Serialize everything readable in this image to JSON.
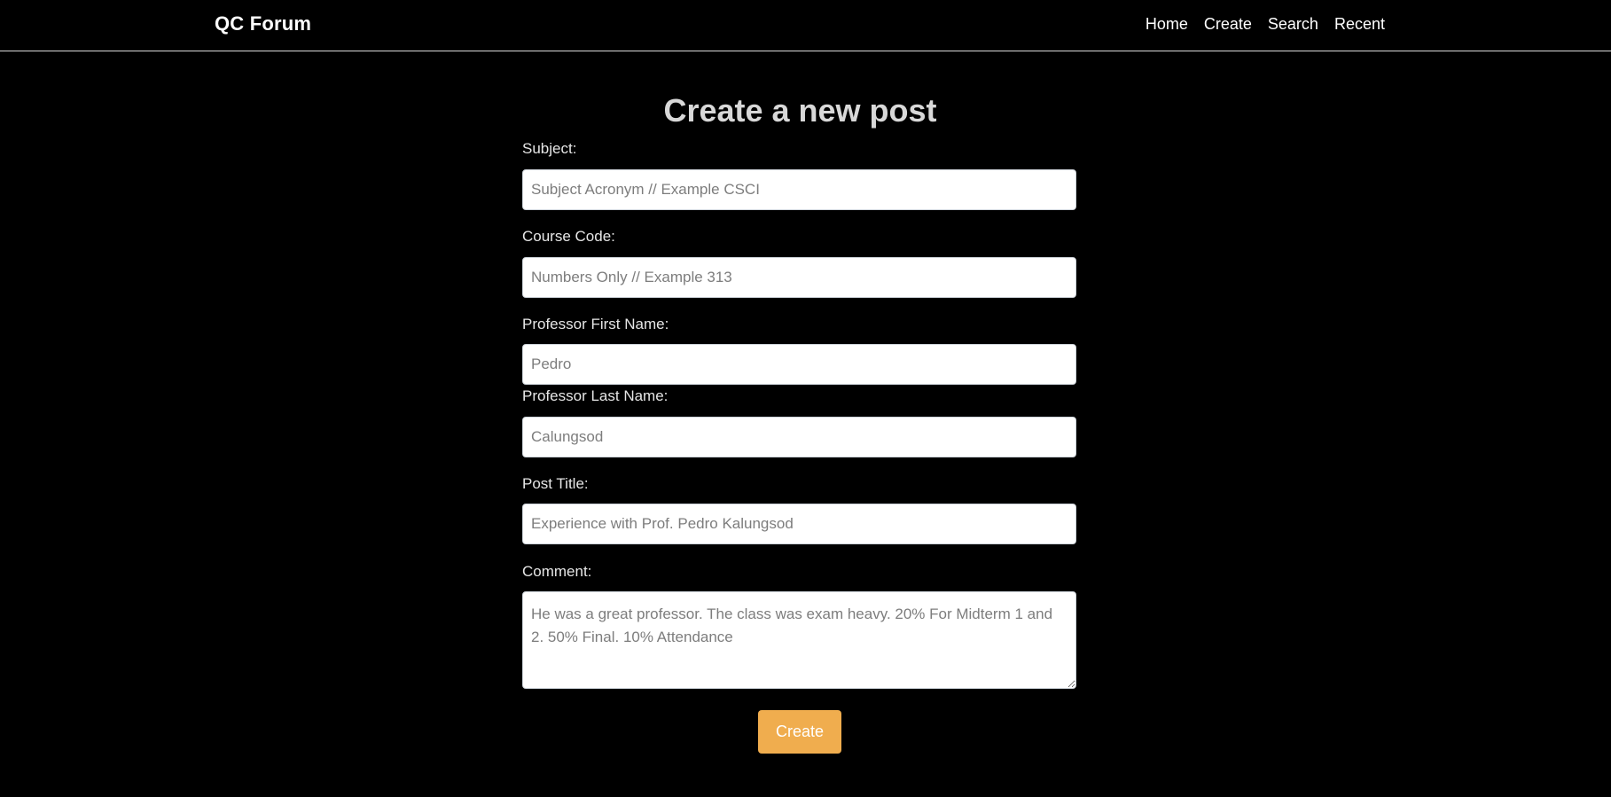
{
  "nav": {
    "brand": "QC Forum",
    "links": [
      "Home",
      "Create",
      "Search",
      "Recent"
    ]
  },
  "page": {
    "title": "Create a new post"
  },
  "form": {
    "subject": {
      "label": "Subject:",
      "placeholder": "Subject Acronym // Example CSCI",
      "value": ""
    },
    "course_code": {
      "label": "Course Code:",
      "placeholder": "Numbers Only // Example 313",
      "value": ""
    },
    "prof_first": {
      "label": "Professor First Name:",
      "placeholder": "Pedro",
      "value": ""
    },
    "prof_last": {
      "label": "Professor Last Name:",
      "placeholder": "Calungsod",
      "value": ""
    },
    "post_title": {
      "label": "Post Title:",
      "placeholder": "Experience with Prof. Pedro Kalungsod",
      "value": ""
    },
    "comment": {
      "label": "Comment:",
      "placeholder": "He was a great professor. The class was exam heavy. 20% For Midterm 1 and 2. 50% Final. 10% Attendance",
      "value": ""
    },
    "submit_label": "Create"
  },
  "colors": {
    "background": "#000000",
    "accent": "#f0ad4e",
    "title": "#d8d8d8"
  }
}
